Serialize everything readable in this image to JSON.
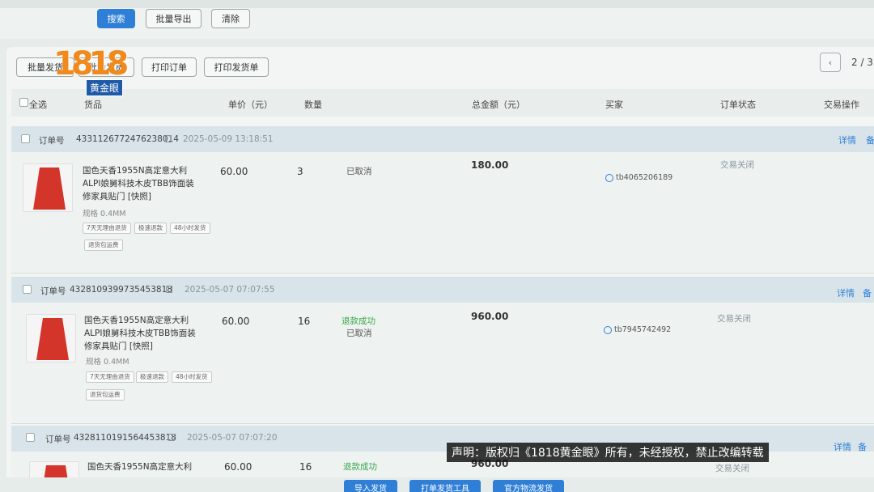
{
  "toolbar_top": {
    "search": "搜索",
    "batch_export": "批量导出",
    "clear": "清除"
  },
  "toolbar": {
    "batch_ship": "批量发货",
    "batch_ship2": "批量发货",
    "print_order": "打印订单",
    "print_ship": "打印发货单"
  },
  "pager": {
    "prev": "‹",
    "text": "2 / 3"
  },
  "columns": {
    "select_all": "全选",
    "goods": "货品",
    "unit_price": "单价（元）",
    "quantity": "数量",
    "total": "总金额（元）",
    "buyer": "买家",
    "status": "订单状态",
    "ops": "交易操作"
  },
  "orders": [
    {
      "label": "订单号",
      "number": "4331126772476238014",
      "time": "2025-05-09 13:18:51",
      "title": "国色天香1955N高定意大利ALPI娘舅科技木皮TBB饰面装修家具贴门 [快照]",
      "spec": "规格 0.4MM",
      "tags": [
        "7天无理由退货",
        "极速退款",
        "48小时发货",
        "退货包运费"
      ],
      "price": "60.00",
      "qty": "3",
      "status1": "已取消",
      "status2": "",
      "total": "180.00",
      "buyer": "tb4065206189",
      "trade": "交易关闭",
      "detail": "详情",
      "remark": "备"
    },
    {
      "label": "订单号",
      "number": "4328109399735453818",
      "time": "2025-05-07 07:07:55",
      "title": "国色天香1955N高定意大利ALPI娘舅科技木皮TBB饰面装修家具贴门 [快照]",
      "spec": "规格 0.4MM",
      "tags": [
        "7天无理由退货",
        "极速退款",
        "48小时发货",
        "退货包运费"
      ],
      "price": "60.00",
      "qty": "16",
      "status1": "退款成功",
      "status2": "已取消",
      "total": "960.00",
      "buyer": "tb7945742492",
      "trade": "交易关闭",
      "detail": "详情",
      "remark": "备"
    },
    {
      "label": "订单号",
      "number": "4328110191564453818",
      "time": "2025-05-07 07:07:20",
      "title": "国色天香1955N高定意大利",
      "price": "60.00",
      "qty": "16",
      "status1": "退款成功",
      "total": "960.00",
      "trade": "交易关闭",
      "detail": "详情",
      "remark": "备注"
    }
  ],
  "bottom_buttons": {
    "import": "导入发货",
    "print_tool": "打单发货工具",
    "official": "官方物流发货"
  },
  "logo": {
    "number": "1818",
    "sub": "黄金眼"
  },
  "disclaimer": "声明：版权归《1818黄金眼》所有，未经授权，禁止改编转载",
  "colors": {
    "accent": "#2f7fd6",
    "success": "#3aa64b",
    "product_red": "#d3352b"
  }
}
